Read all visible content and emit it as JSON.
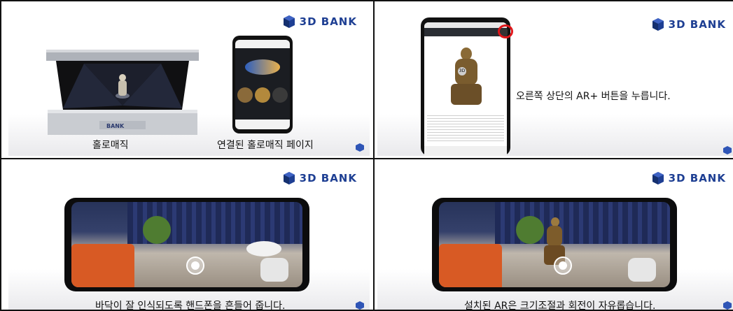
{
  "brand": {
    "name": "3D BANK",
    "color": "#1e3f93"
  },
  "panels": [
    {
      "id": "top-left",
      "captions": {
        "left": "홀로매직",
        "right": "연결된 홀로매직 페이지"
      }
    },
    {
      "id": "top-right",
      "caption": "오른쪽 상단의 AR+ 버튼을 누릅니다."
    },
    {
      "id": "bottom-left",
      "caption": "바닥이 잘 인식되도록 핸드폰을 흔들어 줍니다."
    },
    {
      "id": "bottom-right",
      "caption": "설치된 AR은 크기조절과 회전이 자유롭습니다."
    }
  ]
}
